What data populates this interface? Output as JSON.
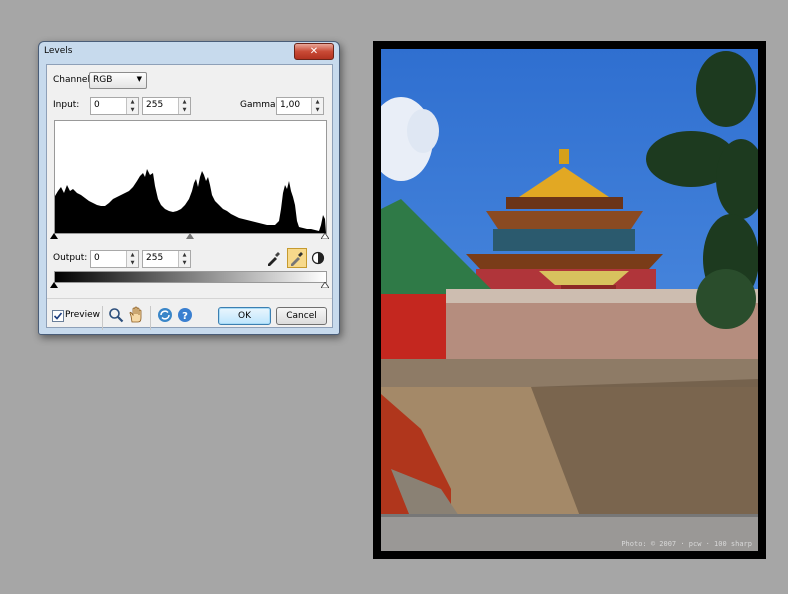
{
  "dialog": {
    "title": "Levels",
    "close_label": "✕",
    "channel": {
      "label": "Channel:",
      "value": "RGB"
    },
    "input": {
      "label": "Input:",
      "black": "0",
      "white": "255"
    },
    "gamma": {
      "label": "Gamma:",
      "value": "1,00"
    },
    "output": {
      "label": "Output:",
      "black": "0",
      "white": "255"
    },
    "preview": {
      "label": "Preview",
      "checked": true
    },
    "ok_label": "OK",
    "cancel_label": "Cancel"
  },
  "photo": {
    "watermark": "Photo:  ©  2007  ·  pcw  ·  100 sharp"
  },
  "colors": {
    "desktop": "#a6a6a6",
    "dialog_frame": "#c7daed",
    "accent": "#3c7fb1"
  }
}
